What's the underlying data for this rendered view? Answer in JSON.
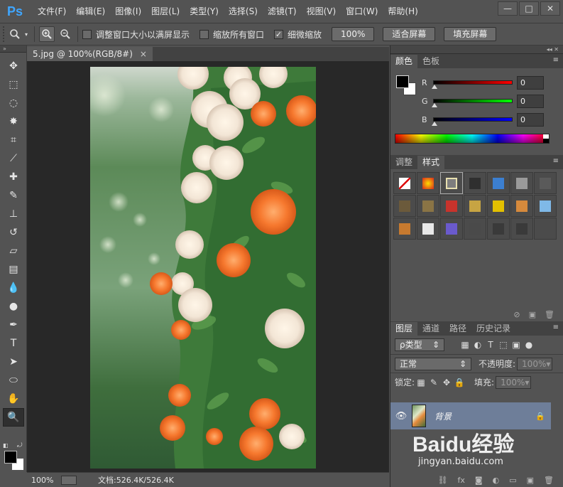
{
  "app": {
    "logo": "Ps",
    "menu": [
      "文件(F)",
      "编辑(E)",
      "图像(I)",
      "图层(L)",
      "类型(Y)",
      "选择(S)",
      "滤镜(T)",
      "视图(V)",
      "窗口(W)",
      "帮助(H)"
    ],
    "window_controls": {
      "minimize": "—",
      "restore": "□",
      "close": "✕"
    }
  },
  "options": {
    "tool_icon": "magnifier-icon",
    "zoom_in_icon": "zoom-in-icon",
    "zoom_out_icon": "zoom-out-icon",
    "resize_windows": {
      "label": "调整窗口大小以满屏显示",
      "checked": false
    },
    "zoom_all": {
      "label": "缩放所有窗口",
      "checked": false
    },
    "scrubby_zoom": {
      "label": "细微缩放",
      "checked": true
    },
    "btn_100": "100%",
    "btn_fit": "适合屏幕",
    "btn_fill": "填充屏幕"
  },
  "tools": [
    {
      "name": "move-tool-icon",
      "glyph": "✥"
    },
    {
      "name": "marquee-tool-icon",
      "glyph": "⬚"
    },
    {
      "name": "lasso-tool-icon",
      "glyph": "◌"
    },
    {
      "name": "magic-wand-tool-icon",
      "glyph": "✸"
    },
    {
      "name": "crop-tool-icon",
      "glyph": "⌗"
    },
    {
      "name": "eyedropper-tool-icon",
      "glyph": "⟋"
    },
    {
      "name": "healing-brush-tool-icon",
      "glyph": "✚"
    },
    {
      "name": "brush-tool-icon",
      "glyph": "✎"
    },
    {
      "name": "clone-stamp-tool-icon",
      "glyph": "⊥"
    },
    {
      "name": "history-brush-tool-icon",
      "glyph": "↺"
    },
    {
      "name": "eraser-tool-icon",
      "glyph": "▱"
    },
    {
      "name": "gradient-tool-icon",
      "glyph": "▤"
    },
    {
      "name": "blur-tool-icon",
      "glyph": "💧"
    },
    {
      "name": "dodge-tool-icon",
      "glyph": "●"
    },
    {
      "name": "pen-tool-icon",
      "glyph": "✒"
    },
    {
      "name": "type-tool-icon",
      "glyph": "T"
    },
    {
      "name": "path-selection-tool-icon",
      "glyph": "➤"
    },
    {
      "name": "ellipse-tool-icon",
      "glyph": "⬭"
    },
    {
      "name": "hand-tool-icon",
      "glyph": "✋"
    },
    {
      "name": "zoom-tool-icon",
      "glyph": "🔍",
      "active": true
    }
  ],
  "document": {
    "tab_title": "5.jpg @ 100%(RGB/8#)",
    "tab_close": "×",
    "zoom": "100%",
    "doc_info": "文档:526.4K/526.4K"
  },
  "color_panel": {
    "tabs": [
      "颜色",
      "色板"
    ],
    "channels": [
      {
        "label": "R",
        "value": "0",
        "color": "#ff0000"
      },
      {
        "label": "G",
        "value": "0",
        "color": "#00ff00"
      },
      {
        "label": "B",
        "value": "0",
        "color": "#0000ff"
      }
    ]
  },
  "styles_panel": {
    "tabs": [
      "调整",
      "样式"
    ],
    "swatches": [
      "#ffffff",
      "#d7261e",
      "#7e7e7e",
      "#2f2f2f",
      "#3c7fd0",
      "#9a9a9a",
      "#5a5a5a",
      "#6b5a3b",
      "#8a7445",
      "#c8332c",
      "#c7a443",
      "#e3c000",
      "#d68a3c",
      "#7fb9e8",
      "#c77a2f",
      "#e8e8e8",
      "#6a5acd",
      "#4a4a4a",
      "#3a3a3a",
      "#3a3a3a",
      ""
    ]
  },
  "layers_panel": {
    "tabs": [
      "图层",
      "通道",
      "路径",
      "历史记录"
    ],
    "filter_label": "ρ类型",
    "blend_mode": "正常",
    "opacity_label": "不透明度:",
    "opacity_value": "100%",
    "lock_label": "锁定:",
    "fill_label": "填充:",
    "fill_value": "100%",
    "layer_name": "背景",
    "footer_icons": [
      "link-icon",
      "fx-icon",
      "mask-icon",
      "adjustment-icon",
      "folder-icon",
      "new-layer-icon",
      "trash-icon"
    ]
  },
  "watermark": {
    "brand": "Baidu经验",
    "url": "jingyan.baidu.com"
  }
}
